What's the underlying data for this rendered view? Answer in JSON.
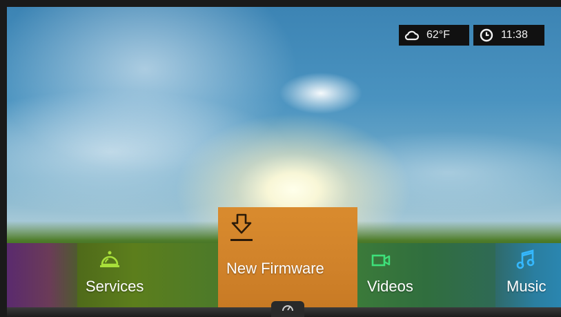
{
  "status": {
    "weather_icon": "cloud-icon",
    "temperature": "62°F",
    "clock_icon": "clock-icon",
    "time": "11:38"
  },
  "menu": {
    "items": [
      {
        "label": "",
        "icon": "none",
        "color": "#6b3b58"
      },
      {
        "label": "Services",
        "icon": "service-bell-icon",
        "color": "#a8e03a"
      },
      {
        "label": "New Firmware",
        "icon": "download-icon",
        "color": "#d98b2e"
      },
      {
        "label": "Videos",
        "icon": "video-camera-icon",
        "color": "#3ee07a"
      },
      {
        "label": "Music",
        "icon": "music-note-icon",
        "color": "#35b8ff"
      }
    ],
    "selected_index": 2
  },
  "dashboard": {
    "icon": "gauge-icon"
  }
}
